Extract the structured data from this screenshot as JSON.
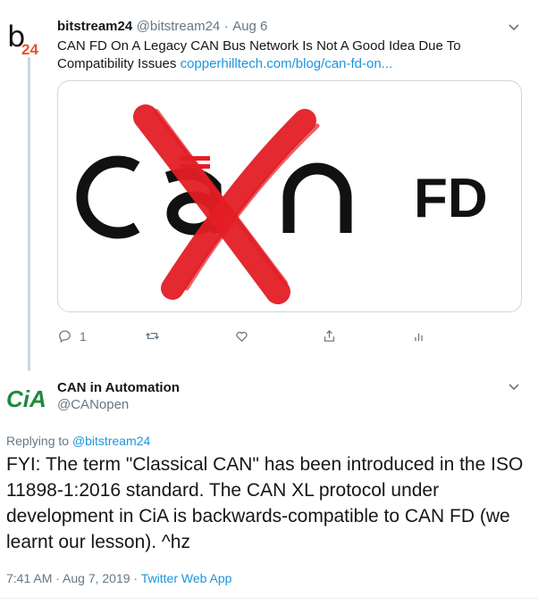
{
  "tweet1": {
    "avatar_text": "b",
    "avatar_number": "24",
    "name": "bitstream24",
    "handle": "@bitstream24",
    "separator": "·",
    "date": "Aug 6",
    "text": "CAN FD On A Legacy CAN Bus Network Is Not A Good Idea Due To Compatibility Issues",
    "link": "copperhilltech.com/blog/can-fd-on...",
    "card": {
      "logo_text": "CAN",
      "logo_suffix": "FD",
      "cross_color": "#e31e25"
    },
    "actions": {
      "reply_count": "1",
      "retweet_count": "",
      "like_count": ""
    }
  },
  "tweet2": {
    "avatar_text": "CiA",
    "avatar_color": "#1f8a3c",
    "name": "CAN in Automation",
    "handle": "@CANopen",
    "replying_prefix": "Replying to",
    "replying_handle": "@bitstream24",
    "body": "FYI: The term \"Classical CAN\" has been introduced in the ISO 11898-1:2016 standard. The CAN XL protocol under development in CiA is backwards-compatible to CAN FD (we learnt our lesson). ^hz",
    "time": "7:41 AM · Aug 7, 2019 ·",
    "source": "Twitter Web App"
  },
  "colors": {
    "link": "#1b95e0",
    "muted": "#657786",
    "border": "#ccd6dd"
  },
  "icons": [
    "chevron-down-icon",
    "reply-icon",
    "retweet-icon",
    "like-icon",
    "share-icon",
    "analytics-icon"
  ]
}
